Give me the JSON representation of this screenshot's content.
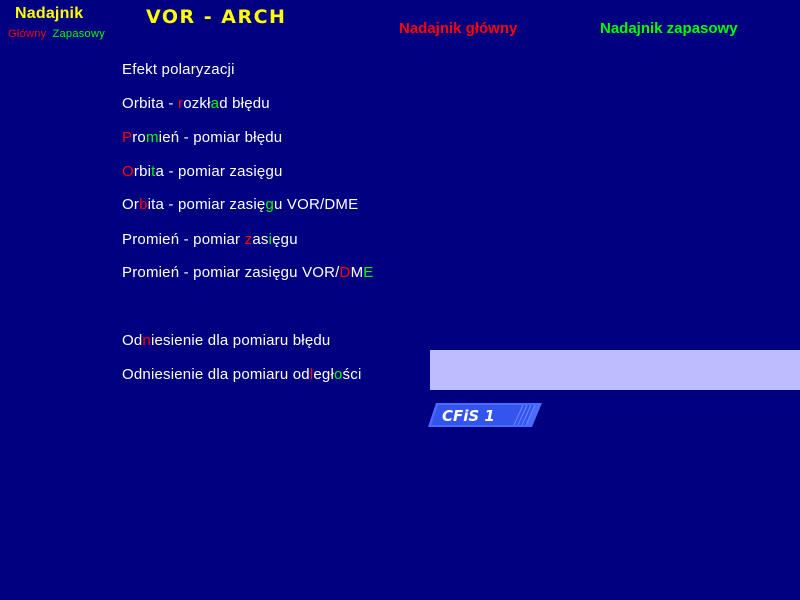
{
  "header": {
    "app_title": "Nadajnik",
    "legend_main": "Główny",
    "legend_backup": "Zapasowy",
    "program_title": "VOR - ARCH",
    "tx_main": "Nadajnik główny",
    "tx_backup": "Nadajnik zapasowy"
  },
  "colors": {
    "background": "#000080",
    "title": "#ffff00",
    "main_tx": "#ff0000",
    "backup_tx": "#00ff00",
    "status_bar": "#bcbcff"
  },
  "menu": [
    {
      "label": "Efekt polaryzacji",
      "segments": [
        {
          "t": "Efekt polaryzacji",
          "c": ""
        }
      ]
    },
    {
      "label": "Orbita - rozkład błędu",
      "segments": [
        {
          "t": "Orbita - ",
          "c": ""
        },
        {
          "t": "r",
          "c": "r"
        },
        {
          "t": "ozkł",
          "c": ""
        },
        {
          "t": "a",
          "c": "g"
        },
        {
          "t": "d błędu",
          "c": ""
        }
      ]
    },
    {
      "label": "Promień - pomiar błędu",
      "segments": [
        {
          "t": "P",
          "c": "r"
        },
        {
          "t": "ro",
          "c": ""
        },
        {
          "t": "m",
          "c": "g"
        },
        {
          "t": "ień - pomiar błędu",
          "c": ""
        }
      ]
    },
    {
      "label": "Orbita - pomiar zasięgu",
      "segments": [
        {
          "t": "O",
          "c": "r"
        },
        {
          "t": "rbi",
          "c": ""
        },
        {
          "t": "t",
          "c": "g"
        },
        {
          "t": "a - pomiar zasięgu",
          "c": ""
        }
      ]
    },
    {
      "label": "Orbita - pomiar zasięgu VOR/DME",
      "segments": [
        {
          "t": "Or",
          "c": ""
        },
        {
          "t": "b",
          "c": "r"
        },
        {
          "t": "ita - pomiar zasię",
          "c": ""
        },
        {
          "t": "g",
          "c": "g"
        },
        {
          "t": "u VOR/DME",
          "c": ""
        }
      ]
    },
    {
      "label": "Promień - pomiar zasięgu",
      "segments": [
        {
          "t": "Promień - pomiar ",
          "c": ""
        },
        {
          "t": "z",
          "c": "r"
        },
        {
          "t": "as",
          "c": ""
        },
        {
          "t": "i",
          "c": "g"
        },
        {
          "t": "ęgu",
          "c": ""
        }
      ]
    },
    {
      "label": "Promień - pomiar zasięgu VOR/DME",
      "segments": [
        {
          "t": "Promień - pomiar zasięgu VOR/",
          "c": ""
        },
        {
          "t": "D",
          "c": "r"
        },
        {
          "t": "M",
          "c": ""
        },
        {
          "t": "E",
          "c": "g"
        }
      ]
    },
    {
      "label": "Odniesienie dla pomiaru błędu",
      "segments": [
        {
          "t": "Od",
          "c": ""
        },
        {
          "t": "n",
          "c": "r"
        },
        {
          "t": "iesienie dla pomiaru błędu",
          "c": ""
        }
      ]
    },
    {
      "label": "Odniesienie dla pomiaru odległości",
      "segments": [
        {
          "t": "Odniesienie dla pomiaru od",
          "c": ""
        },
        {
          "t": "l",
          "c": "r"
        },
        {
          "t": "egł",
          "c": ""
        },
        {
          "t": "o",
          "c": "g"
        },
        {
          "t": "ści",
          "c": ""
        }
      ]
    }
  ],
  "logo": {
    "text": "CFiS 1",
    "icon": "cfis-logo-icon"
  }
}
